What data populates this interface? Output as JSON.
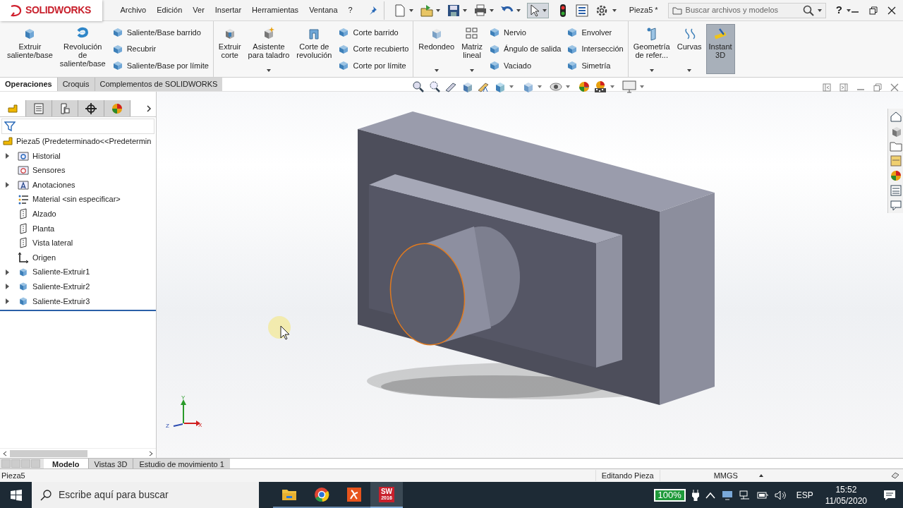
{
  "app": {
    "logo": "SOLIDWORKS"
  },
  "menu": [
    "Archivo",
    "Edición",
    "Ver",
    "Insertar",
    "Herramientas",
    "Ventana",
    "?"
  ],
  "document_title": "Pieza5 *",
  "search": {
    "placeholder": "Buscar archivos y modelos"
  },
  "help": "?",
  "ribbon": [
    {
      "items": [
        {
          "kind": "large",
          "label": "Extruir\nsaliente/base",
          "dropdown": false,
          "active": false
        },
        {
          "kind": "large",
          "label": "Revolución\nde\nsaliente/base",
          "dropdown": false,
          "active": false
        },
        {
          "kind": "stack",
          "items": [
            "Saliente/Base barrido",
            "Recubrir",
            "Saliente/Base por límite"
          ]
        }
      ]
    },
    {
      "items": [
        {
          "kind": "large",
          "label": "Extruir\ncorte",
          "dropdown": false,
          "active": false
        },
        {
          "kind": "large",
          "label": "Asistente\npara taladro",
          "dropdown": true,
          "active": false
        },
        {
          "kind": "large",
          "label": "Corte de\nrevolución",
          "dropdown": false,
          "active": false
        },
        {
          "kind": "stack",
          "items": [
            "Corte barrido",
            "Corte recubierto",
            "Corte por límite"
          ]
        }
      ]
    },
    {
      "items": [
        {
          "kind": "large",
          "label": "Redondeo",
          "dropdown": true,
          "active": false
        },
        {
          "kind": "large",
          "label": "Matriz\nlineal",
          "dropdown": true,
          "active": false
        },
        {
          "kind": "stack",
          "items": [
            "Nervio",
            "Ángulo de salida",
            "Vaciado"
          ]
        },
        {
          "kind": "stack",
          "items": [
            "Envolver",
            "Intersección",
            "Simetría"
          ]
        }
      ]
    },
    {
      "items": [
        {
          "kind": "large",
          "label": "Geometría\nde refer...",
          "dropdown": true,
          "active": false
        },
        {
          "kind": "large",
          "label": "Curvas",
          "dropdown": true,
          "active": false
        },
        {
          "kind": "large",
          "label": "Instant\n3D",
          "dropdown": false,
          "active": true
        }
      ]
    }
  ],
  "command_tabs": [
    {
      "label": "Operaciones",
      "selected": true
    },
    {
      "label": "Croquis",
      "selected": false
    },
    {
      "label": "Complementos de SOLIDWORKS",
      "selected": false
    }
  ],
  "panel_tabs": [
    {
      "kind": "features",
      "selected": true
    },
    {
      "kind": "properties",
      "selected": false
    },
    {
      "kind": "configurations",
      "selected": false
    },
    {
      "kind": "dimxpert",
      "selected": false
    },
    {
      "kind": "display",
      "selected": false
    }
  ],
  "tree": {
    "root": {
      "kind": "part",
      "label": "Pieza5  (Predeterminado<<Predetermin"
    },
    "children": [
      {
        "kind": "history",
        "label": "Historial",
        "expandable": true
      },
      {
        "kind": "sensors",
        "label": "Sensores",
        "expandable": false
      },
      {
        "kind": "annotations",
        "label": "Anotaciones",
        "expandable": true
      },
      {
        "kind": "material",
        "label": "Material <sin especificar>",
        "expandable": false
      },
      {
        "kind": "plane",
        "label": "Alzado",
        "expandable": false
      },
      {
        "kind": "plane",
        "label": "Planta",
        "expandable": false
      },
      {
        "kind": "plane",
        "label": "Vista lateral",
        "expandable": false
      },
      {
        "kind": "origin",
        "label": "Origen",
        "expandable": false
      },
      {
        "kind": "feature",
        "label": "Saliente-Extruir1",
        "expandable": true
      },
      {
        "kind": "feature",
        "label": "Saliente-Extruir2",
        "expandable": true
      },
      {
        "kind": "feature",
        "label": "Saliente-Extruir3",
        "expandable": true
      }
    ]
  },
  "triad": {
    "x": "X",
    "y": "Y",
    "z": "Z"
  },
  "bottom_tabs": [
    {
      "label": "Modelo",
      "selected": true
    },
    {
      "label": "Vistas 3D",
      "selected": false
    },
    {
      "label": "Estudio de movimiento 1",
      "selected": false
    }
  ],
  "status_bar": {
    "document": "Pieza5",
    "mode": "Editando Pieza",
    "units": "MMGS"
  },
  "taskbar": {
    "search_placeholder": "Escribe aquí para buscar",
    "apps": [
      {
        "kind": "folder",
        "active": false
      },
      {
        "kind": "browser",
        "active": false
      },
      {
        "kind": "pdf",
        "active": false
      },
      {
        "kind": "cad",
        "label": "SW",
        "sublabel": "2016",
        "active": true
      }
    ],
    "battery": "100%",
    "language": "ESP",
    "time": "15:52",
    "date": "11/05/2020"
  }
}
